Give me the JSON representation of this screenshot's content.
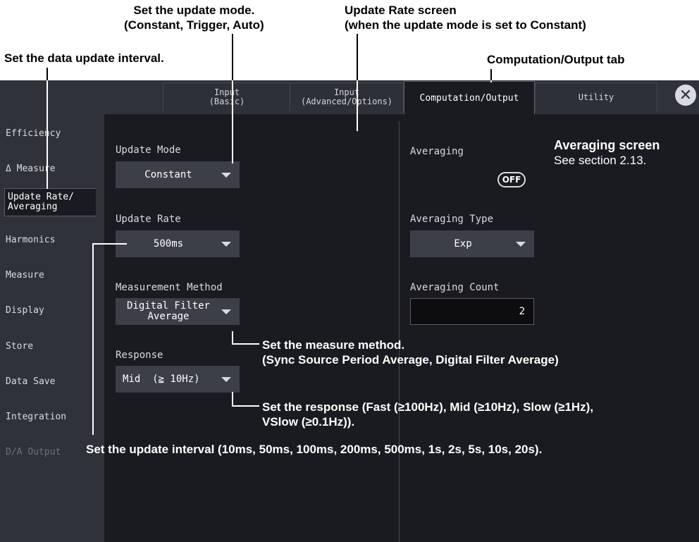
{
  "tabs": [
    {
      "label_1": "Input",
      "label_2": "(Basic)"
    },
    {
      "label_1": "Input",
      "label_2": "(Advanced/Options)"
    },
    {
      "label_1": "Computation/Output"
    },
    {
      "label_1": "Utility"
    }
  ],
  "close_icon": "close-icon",
  "sidebar": {
    "items": [
      {
        "label": "Efficiency"
      },
      {
        "label": "Δ Measure"
      },
      {
        "label_1": "Update Rate/",
        "label_2": "Averaging"
      },
      {
        "label": "Harmonics"
      },
      {
        "label": "Measure"
      },
      {
        "label": "Display"
      },
      {
        "label": "Store"
      },
      {
        "label": "Data Save"
      },
      {
        "label": "Integration"
      },
      {
        "label": "D/A Output"
      }
    ]
  },
  "left_panel": {
    "update_mode_label": "Update Mode",
    "update_mode_value": "Constant",
    "update_rate_label": "Update Rate",
    "update_rate_value": "500ms",
    "measurement_method_label": "Measurement Method",
    "measurement_method_value_1": "Digital Filter",
    "measurement_method_value_2": "Average",
    "response_label": "Response",
    "response_value": "Mid  (≧ 10Hz)"
  },
  "right_panel": {
    "averaging_label": "Averaging",
    "averaging_state": "OFF",
    "averaging_type_label": "Averaging Type",
    "averaging_type_value": "Exp",
    "averaging_count_label": "Averaging Count",
    "averaging_count_value": "2"
  },
  "annotations": {
    "update_mode_1": "Set the update mode.",
    "update_mode_2": "(Constant, Trigger, Auto)",
    "screen_title_1": "Update Rate screen",
    "screen_title_2": "(when the update mode is set to Constant)",
    "interval": "Set the data update interval.",
    "tab_note": "Computation/Output tab",
    "averaging_screen_1": "Averaging screen",
    "averaging_screen_2": "See section 2.13.",
    "measure_method_1": "Set the measure method.",
    "measure_method_2": "(Sync Source Period Average, Digital Filter Average)",
    "response_1": "Set the response (Fast (≥100Hz), Mid (≥10Hz), Slow (≥1Hz),",
    "response_2": "VSlow (≥0.1Hz)).",
    "update_interval": "Set the update interval (10ms, 50ms, 100ms, 200ms, 500ms, 1s, 2s, 5s, 10s, 20s)."
  }
}
